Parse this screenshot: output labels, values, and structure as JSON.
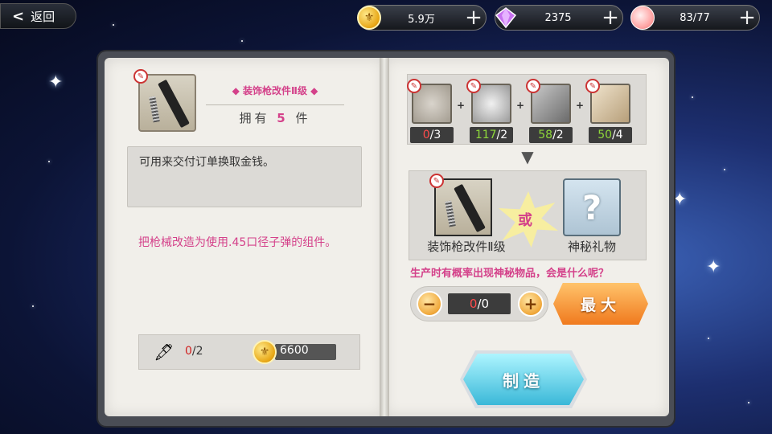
{
  "top": {
    "back_label": "返回",
    "resources": [
      {
        "icon": "coin-icon",
        "value": "5.9万"
      },
      {
        "icon": "gem-icon",
        "value": "2375"
      },
      {
        "icon": "peach-icon",
        "value": "83/77"
      }
    ]
  },
  "item": {
    "name": "装饰枪改件Ⅱ级",
    "owned_prefix": "拥有",
    "owned_count": "5",
    "owned_suffix": "件",
    "description": "可用来交付订单换取金钱。",
    "note": "把枪械改造为使用.45口径子弹的组件。",
    "order_have": "0",
    "order_total": "/2",
    "gold_cost": "6600"
  },
  "materials": [
    {
      "have": "0",
      "need": "/3",
      "sufficient": false
    },
    {
      "have": "117",
      "need": "/2",
      "sufficient": true
    },
    {
      "have": "58",
      "need": "/2",
      "sufficient": true
    },
    {
      "have": "50",
      "need": "/4",
      "sufficient": true
    }
  ],
  "result": {
    "or_label": "或",
    "main_label": "装饰枪改件Ⅱ级",
    "mystery_label": "神秘礼物",
    "hint": "生产时有概率出现神秘物品，会是什么呢？"
  },
  "quantity": {
    "current": "0",
    "max_text": "/0",
    "minus": "−",
    "plus": "+",
    "max_label": "最大"
  },
  "make_label": "制造"
}
